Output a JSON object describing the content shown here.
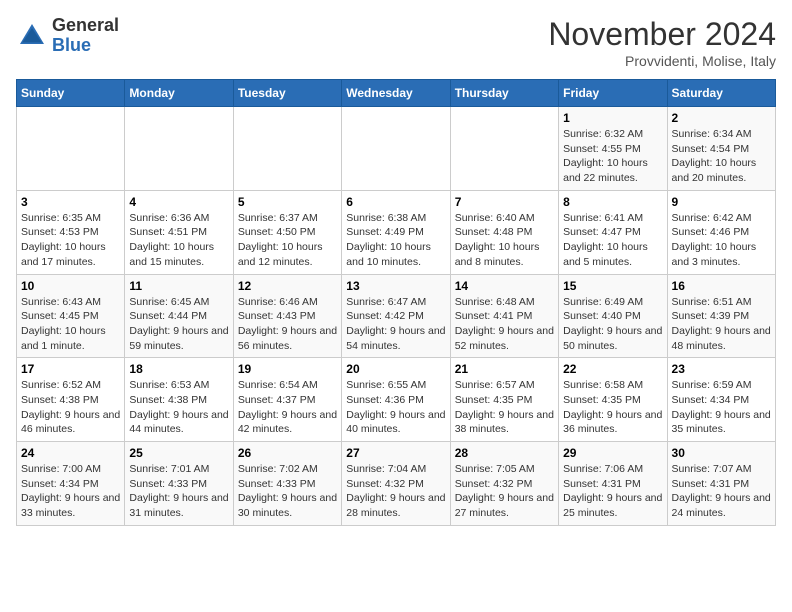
{
  "header": {
    "logo_general": "General",
    "logo_blue": "Blue",
    "month_title": "November 2024",
    "location": "Provvidenti, Molise, Italy"
  },
  "weekdays": [
    "Sunday",
    "Monday",
    "Tuesday",
    "Wednesday",
    "Thursday",
    "Friday",
    "Saturday"
  ],
  "weeks": [
    [
      {
        "day": "",
        "info": ""
      },
      {
        "day": "",
        "info": ""
      },
      {
        "day": "",
        "info": ""
      },
      {
        "day": "",
        "info": ""
      },
      {
        "day": "",
        "info": ""
      },
      {
        "day": "1",
        "info": "Sunrise: 6:32 AM\nSunset: 4:55 PM\nDaylight: 10 hours and 22 minutes."
      },
      {
        "day": "2",
        "info": "Sunrise: 6:34 AM\nSunset: 4:54 PM\nDaylight: 10 hours and 20 minutes."
      }
    ],
    [
      {
        "day": "3",
        "info": "Sunrise: 6:35 AM\nSunset: 4:53 PM\nDaylight: 10 hours and 17 minutes."
      },
      {
        "day": "4",
        "info": "Sunrise: 6:36 AM\nSunset: 4:51 PM\nDaylight: 10 hours and 15 minutes."
      },
      {
        "day": "5",
        "info": "Sunrise: 6:37 AM\nSunset: 4:50 PM\nDaylight: 10 hours and 12 minutes."
      },
      {
        "day": "6",
        "info": "Sunrise: 6:38 AM\nSunset: 4:49 PM\nDaylight: 10 hours and 10 minutes."
      },
      {
        "day": "7",
        "info": "Sunrise: 6:40 AM\nSunset: 4:48 PM\nDaylight: 10 hours and 8 minutes."
      },
      {
        "day": "8",
        "info": "Sunrise: 6:41 AM\nSunset: 4:47 PM\nDaylight: 10 hours and 5 minutes."
      },
      {
        "day": "9",
        "info": "Sunrise: 6:42 AM\nSunset: 4:46 PM\nDaylight: 10 hours and 3 minutes."
      }
    ],
    [
      {
        "day": "10",
        "info": "Sunrise: 6:43 AM\nSunset: 4:45 PM\nDaylight: 10 hours and 1 minute."
      },
      {
        "day": "11",
        "info": "Sunrise: 6:45 AM\nSunset: 4:44 PM\nDaylight: 9 hours and 59 minutes."
      },
      {
        "day": "12",
        "info": "Sunrise: 6:46 AM\nSunset: 4:43 PM\nDaylight: 9 hours and 56 minutes."
      },
      {
        "day": "13",
        "info": "Sunrise: 6:47 AM\nSunset: 4:42 PM\nDaylight: 9 hours and 54 minutes."
      },
      {
        "day": "14",
        "info": "Sunrise: 6:48 AM\nSunset: 4:41 PM\nDaylight: 9 hours and 52 minutes."
      },
      {
        "day": "15",
        "info": "Sunrise: 6:49 AM\nSunset: 4:40 PM\nDaylight: 9 hours and 50 minutes."
      },
      {
        "day": "16",
        "info": "Sunrise: 6:51 AM\nSunset: 4:39 PM\nDaylight: 9 hours and 48 minutes."
      }
    ],
    [
      {
        "day": "17",
        "info": "Sunrise: 6:52 AM\nSunset: 4:38 PM\nDaylight: 9 hours and 46 minutes."
      },
      {
        "day": "18",
        "info": "Sunrise: 6:53 AM\nSunset: 4:38 PM\nDaylight: 9 hours and 44 minutes."
      },
      {
        "day": "19",
        "info": "Sunrise: 6:54 AM\nSunset: 4:37 PM\nDaylight: 9 hours and 42 minutes."
      },
      {
        "day": "20",
        "info": "Sunrise: 6:55 AM\nSunset: 4:36 PM\nDaylight: 9 hours and 40 minutes."
      },
      {
        "day": "21",
        "info": "Sunrise: 6:57 AM\nSunset: 4:35 PM\nDaylight: 9 hours and 38 minutes."
      },
      {
        "day": "22",
        "info": "Sunrise: 6:58 AM\nSunset: 4:35 PM\nDaylight: 9 hours and 36 minutes."
      },
      {
        "day": "23",
        "info": "Sunrise: 6:59 AM\nSunset: 4:34 PM\nDaylight: 9 hours and 35 minutes."
      }
    ],
    [
      {
        "day": "24",
        "info": "Sunrise: 7:00 AM\nSunset: 4:34 PM\nDaylight: 9 hours and 33 minutes."
      },
      {
        "day": "25",
        "info": "Sunrise: 7:01 AM\nSunset: 4:33 PM\nDaylight: 9 hours and 31 minutes."
      },
      {
        "day": "26",
        "info": "Sunrise: 7:02 AM\nSunset: 4:33 PM\nDaylight: 9 hours and 30 minutes."
      },
      {
        "day": "27",
        "info": "Sunrise: 7:04 AM\nSunset: 4:32 PM\nDaylight: 9 hours and 28 minutes."
      },
      {
        "day": "28",
        "info": "Sunrise: 7:05 AM\nSunset: 4:32 PM\nDaylight: 9 hours and 27 minutes."
      },
      {
        "day": "29",
        "info": "Sunrise: 7:06 AM\nSunset: 4:31 PM\nDaylight: 9 hours and 25 minutes."
      },
      {
        "day": "30",
        "info": "Sunrise: 7:07 AM\nSunset: 4:31 PM\nDaylight: 9 hours and 24 minutes."
      }
    ]
  ]
}
